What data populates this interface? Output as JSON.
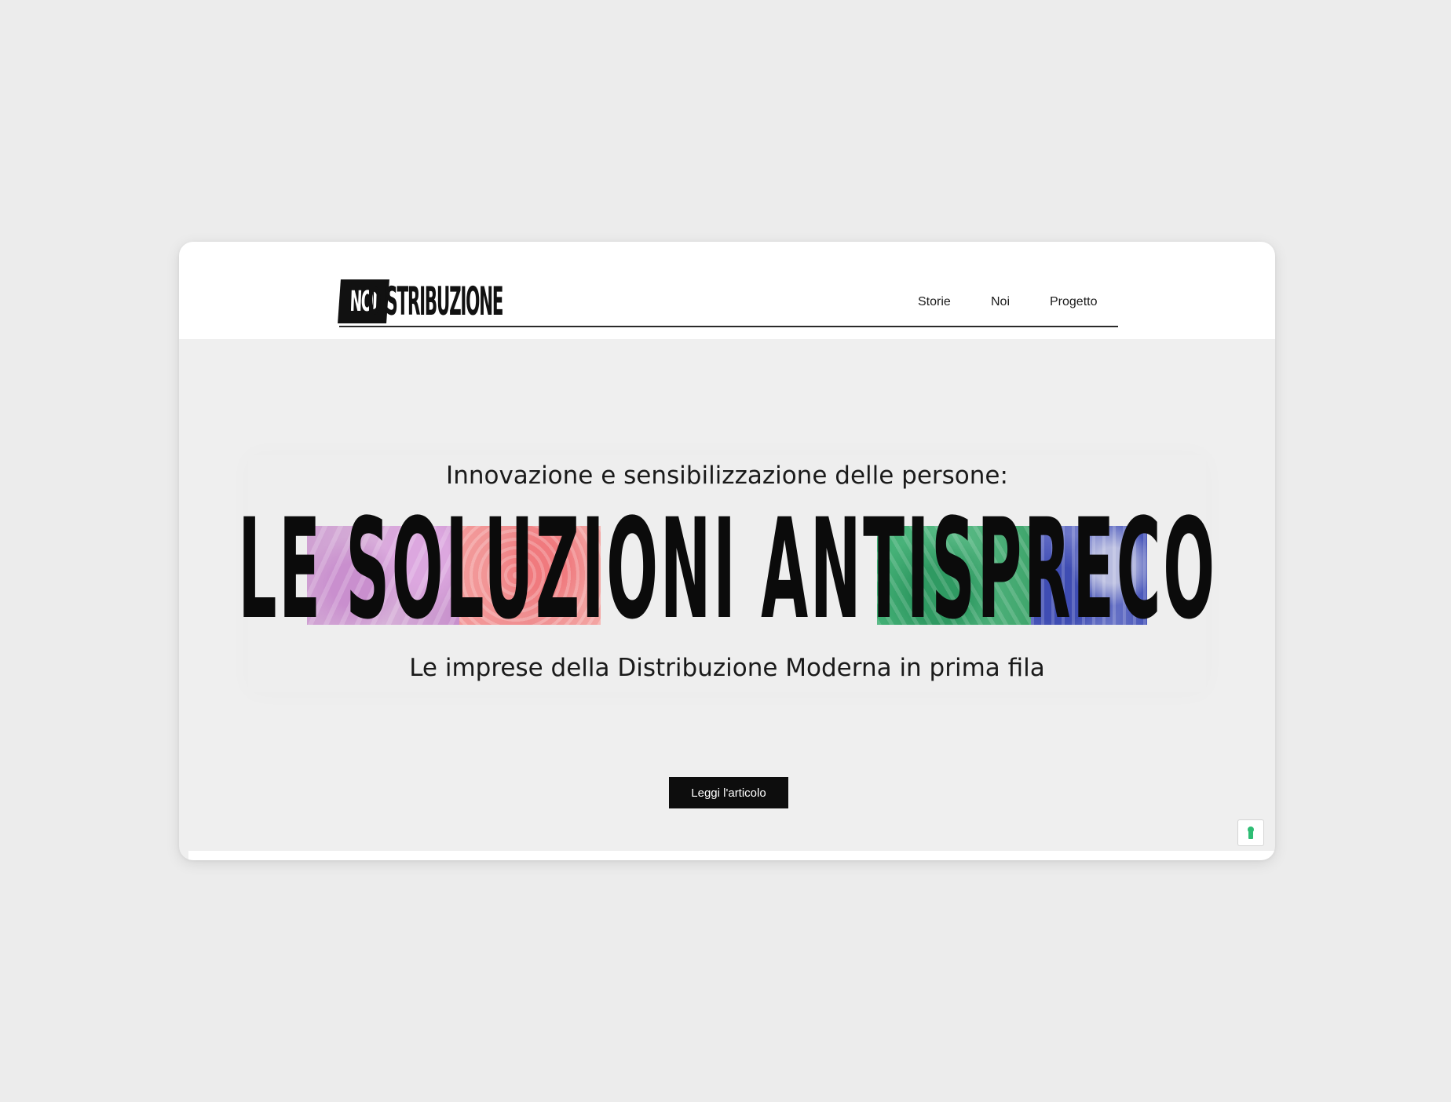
{
  "site": {
    "logo_left": "NOI",
    "logo_right": "DISTRIBUZIONE"
  },
  "nav": {
    "items": [
      {
        "label": "Storie"
      },
      {
        "label": "Noi"
      },
      {
        "label": "Progetto"
      }
    ]
  },
  "hero": {
    "subtitle": "Innovazione e sensibilizzazione delle persone:",
    "headline": "LE SOLUZIONI ANTISPRECO",
    "tagline": "Le imprese della Distribuzione Moderna in prima fila",
    "cta_label": "Leggi l'articolo"
  },
  "colors": {
    "page_background": "#ececec",
    "header_background": "#ffffff",
    "text": "#111111",
    "button_background": "#0d0d0d",
    "photo_violet": "#cf9fd3",
    "photo_red": "#f0898c",
    "photo_green": "#43ad72",
    "photo_blue": "#5561c0",
    "cookie_icon": "#2ebd74"
  },
  "icons": {
    "cookie_settings": "keyhole-icon"
  }
}
